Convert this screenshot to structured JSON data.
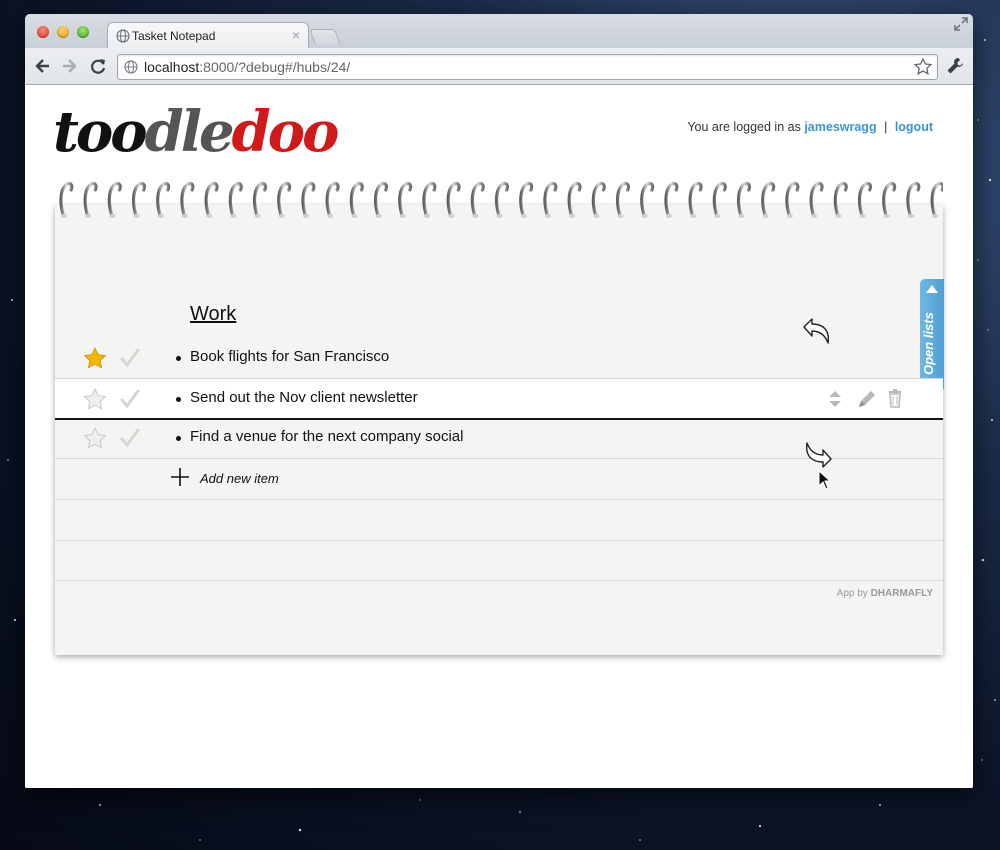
{
  "browser": {
    "tab_title": "Tasket Notepad",
    "tab_close": "×",
    "url_host": "localhost",
    "url_path": ":8000/?debug#/hubs/24/"
  },
  "header": {
    "logo": [
      "too",
      "dle",
      "doo"
    ],
    "login_prefix": "You are logged in as",
    "username": "jameswragg",
    "separator": "|",
    "logout": "logout"
  },
  "notepad": {
    "open_lists_label": "Open lists",
    "list_title": "Work",
    "items": [
      {
        "text": "Book flights for San Francisco",
        "starred": true,
        "done": false
      },
      {
        "text": "Send out the Nov client newsletter",
        "starred": false,
        "done": false
      },
      {
        "text": "Find a venue for the next company social",
        "starred": false,
        "done": false
      }
    ],
    "add_label": "Add new item",
    "footer_prefix": "App by",
    "footer_brand": "DHARMAFLY"
  },
  "colors": {
    "accent": "#3f94d4",
    "logo_red": "#d01a1a",
    "star_gold": "#f2b705",
    "tab_blue": "#5aa8da"
  }
}
